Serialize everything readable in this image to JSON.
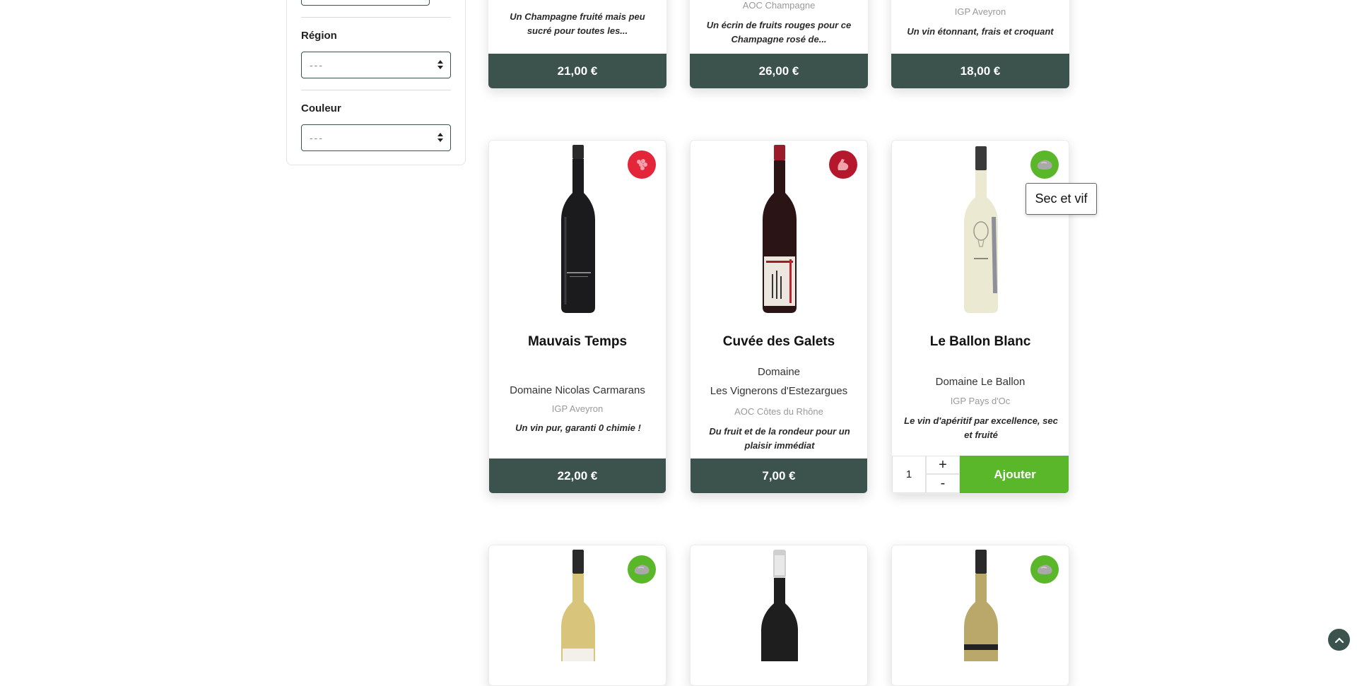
{
  "filters": {
    "region": {
      "label": "Région",
      "value": "---"
    },
    "color": {
      "label": "Couleur",
      "value": "---"
    }
  },
  "top_row": [
    {
      "appellation": "",
      "tagline": "Un Champagne fruité mais peu sucré pour toutes les...",
      "price": "21,00 €"
    },
    {
      "appellation": "AOC Champagne",
      "tagline": "Un écrin de fruits rouges pour ce Champagne rosé de...",
      "price": "26,00 €"
    },
    {
      "appellation": "IGP Aveyron",
      "tagline": "Un vin étonnant, frais et croquant",
      "price": "18,00 €"
    }
  ],
  "middle_row": [
    {
      "name": "Mauvais Temps",
      "domain_line1": "Domaine  Nicolas Carmarans",
      "appellation": "IGP Aveyron",
      "tagline": "Un vin pur, garanti 0 chimie !",
      "price": "22,00 €",
      "badge_icon": "grapes-icon",
      "badge_color": "#e3263a"
    },
    {
      "name": "Cuvée des Galets",
      "domain_line1": "Domaine",
      "domain_line2": "Les Vignerons d'Estezargues",
      "appellation": "AOC Côtes du Rhône",
      "tagline": "Du fruit et de la rondeur pour un plaisir immédiat",
      "price": "7,00 €",
      "badge_icon": "muscle-arm-icon",
      "badge_color": "#b5182c"
    },
    {
      "name": "Le Ballon Blanc",
      "domain_line1": "Domaine  Le Ballon",
      "appellation": "IGP Pays d'Oc",
      "tagline": "Le vin d'apéritif par excellence, sec et fruité",
      "quantity": "1",
      "plus": "+",
      "minus": "-",
      "add_label": "Ajouter",
      "badge_icon": "stone-icon",
      "badge_color": "#5ab72a",
      "tooltip": "Sec et vif"
    }
  ],
  "bottom_row": [
    {
      "badge_icon": "stone-icon",
      "badge_color": "#5ab72a"
    },
    {
      "badge_icon": ""
    },
    {
      "badge_icon": "stone-icon",
      "badge_color": "#5ab72a"
    }
  ],
  "colors": {
    "primary_dark": "#3b524d",
    "accent_green": "#5ab72a",
    "accent_red": "#e3263a"
  }
}
